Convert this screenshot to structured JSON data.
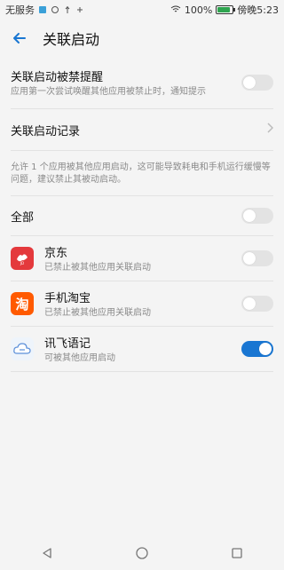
{
  "status": {
    "carrier": "无服务",
    "battery_percent": "100%",
    "time": "傍晚5:23"
  },
  "header": {
    "title": "关联启动"
  },
  "settings": {
    "prompt": {
      "title": "关联启动被禁提醒",
      "subtitle": "应用第一次尝试唤醒其他应用被禁止时，通知提示",
      "enabled": false
    },
    "log": {
      "title": "关联启动记录"
    },
    "note": "允许 1 个应用被其他应用启动，这可能导致耗电和手机运行缓慢等问题，建议禁止其被动启动。",
    "all": {
      "title": "全部",
      "enabled": false
    }
  },
  "apps": [
    {
      "name": "京东",
      "status": "已禁止被其他应用关联启动",
      "icon": "jd-icon",
      "enabled": false,
      "icon_color": "#e4393c"
    },
    {
      "name": "手机淘宝",
      "status": "已禁止被其他应用关联启动",
      "icon": "taobao-icon",
      "enabled": false,
      "icon_color": "#ff5a00"
    },
    {
      "name": "讯飞语记",
      "status": "可被其他应用启动",
      "icon": "iflynote-icon",
      "enabled": true,
      "icon_color": "#5b8fd9"
    }
  ],
  "theme": {
    "accent": "#1976d2"
  }
}
